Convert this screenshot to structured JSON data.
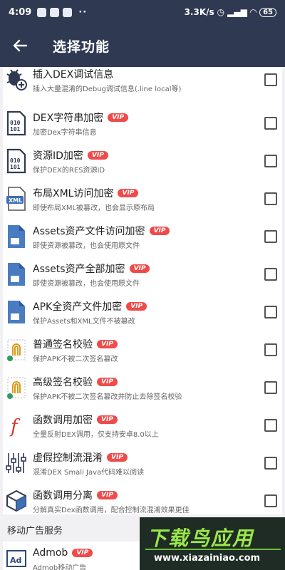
{
  "status": {
    "time": "4:09",
    "speed": "3.3K/s",
    "battery": "65"
  },
  "toolbar": {
    "title": "选择功能"
  },
  "items": [
    {
      "title": "插入DEX调试信息",
      "vip": "",
      "sub": "插入大量混淆的Debug调试信息(.line local等)",
      "icon": "bug-plus-icon"
    },
    {
      "title": "DEX字符串加密",
      "vip": "VIP",
      "sub": "加密Dex字符串信息",
      "icon": "binary-file-icon"
    },
    {
      "title": "资源ID加密",
      "vip": "VIP",
      "sub": "保护DEX的RES资源ID",
      "icon": "binary-file-icon"
    },
    {
      "title": "布局XML访问加密",
      "vip": "VIP",
      "sub": "即使布局XML被篡改，也会显示原布局",
      "icon": "xml-file-icon"
    },
    {
      "title": "Assets资产文件访问加密",
      "vip": "VIP",
      "sub": "即使资源被篡改，也会使用原文件",
      "icon": "document-icon"
    },
    {
      "title": "Assets资产全部加密",
      "vip": "VIP",
      "sub": "即使资源被篡改，也会使用原文件",
      "icon": "document-icon"
    },
    {
      "title": "APK全资产文件加密",
      "vip": "VIP",
      "sub": "保护Assets和XML文件不被篡改",
      "icon": "document-icon"
    },
    {
      "title": "普通签名校验",
      "vip": "VIP",
      "sub": "保护APK不被二次签名篡改",
      "icon": "fingerprint-icon"
    },
    {
      "title": "高级签名校验",
      "vip": "VIP",
      "sub": "保护APK不被二次签名篡改并防止去除签名校验",
      "icon": "fingerprint-icon"
    },
    {
      "title": "函数调用加密",
      "vip": "VIP",
      "sub": "全量反射DEX调用，仅支持安卓8.0以上",
      "icon": "function-icon"
    },
    {
      "title": "虚假控制流混淆",
      "vip": "VIP",
      "sub": "混淆DEX Smali Java代码难以阅读",
      "icon": "sliders-icon"
    },
    {
      "title": "函数调用分离",
      "vip": "VIP",
      "sub": "分解真实Dex函数调用，配合控制流混淆效果更佳",
      "icon": "cube-icon"
    }
  ],
  "section": {
    "title": "移动广告服务"
  },
  "ad_item": {
    "title": "Admob",
    "vip": "VIP",
    "sub": "Admob移动广告",
    "icon": "ad-icon"
  },
  "watermark": {
    "big": "下载鸟应用",
    "small": "www.xiazainiao.com"
  },
  "colors": {
    "header": "#303952",
    "vip": "#f04a4a",
    "background": "#f1f1f3"
  }
}
